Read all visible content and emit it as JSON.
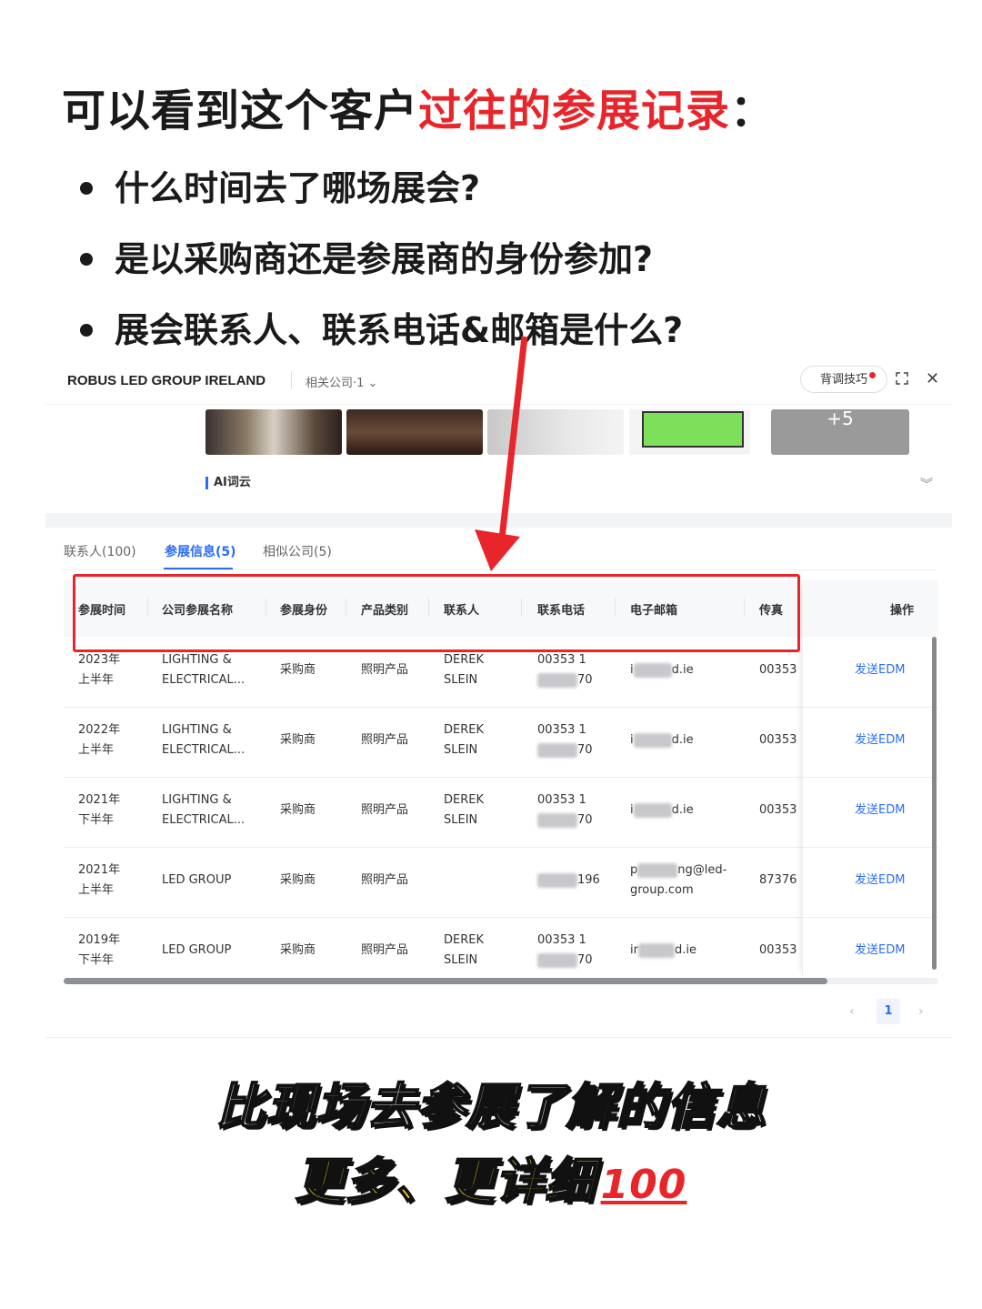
{
  "headline": {
    "prefix": "可以看到这个客户",
    "highlight": "过往的参展记录",
    "suffix": "：",
    "highlight_color": "#e8252a"
  },
  "bullets": [
    "什么时间去了哪场展会?",
    "是以采购商还是参展商的身份参加?",
    "展会联系人、联系电话&邮箱是什么?"
  ],
  "panel": {
    "company": "ROBUS LED GROUP IRELAND",
    "related": "相关公司·1",
    "tips_button": "背调技巧",
    "thumbnail_more": "+5",
    "ai_section": "AI词云",
    "tabs": [
      {
        "label": "联系人(100)",
        "active": false
      },
      {
        "label": "参展信息(5)",
        "active": true
      },
      {
        "label": "相似公司(5)",
        "active": false
      }
    ],
    "columns": [
      "参展时间",
      "公司参展名称",
      "参展身份",
      "产品类别",
      "联系人",
      "联系电话",
      "电子邮箱",
      "传真",
      "操作"
    ],
    "rows": [
      {
        "time1": "2023年",
        "time2": "上半年",
        "name1": "LIGHTING &",
        "name2": "ELECTRICAL...",
        "role": "采购商",
        "category": "照明产品",
        "contact1": "DEREK",
        "contact2": "SLEIN",
        "phone1": "00353 1",
        "phone2": "70",
        "email_pre": "i",
        "email_post": "d.ie",
        "fax": "00353",
        "action": "发送EDM"
      },
      {
        "time1": "2022年",
        "time2": "上半年",
        "name1": "LIGHTING &",
        "name2": "ELECTRICAL...",
        "role": "采购商",
        "category": "照明产品",
        "contact1": "DEREK",
        "contact2": "SLEIN",
        "phone1": "00353 1",
        "phone2": "70",
        "email_pre": "i",
        "email_post": "d.ie",
        "fax": "00353",
        "action": "发送EDM"
      },
      {
        "time1": "2021年",
        "time2": "下半年",
        "name1": "LIGHTING &",
        "name2": "ELECTRICAL...",
        "role": "采购商",
        "category": "照明产品",
        "contact1": "DEREK",
        "contact2": "SLEIN",
        "phone1": "00353 1",
        "phone2": "70",
        "email_pre": "i",
        "email_post": "d.ie",
        "fax": "00353",
        "action": "发送EDM"
      },
      {
        "time1": "2021年",
        "time2": "上半年",
        "name1": "LED GROUP",
        "name2": "",
        "role": "采购商",
        "category": "照明产品",
        "contact1": "",
        "contact2": "",
        "phone1": "196",
        "phone2": "",
        "email_pre": "p",
        "email_post": "ng@led-",
        "email_line2": "group.com",
        "fax": "87376",
        "action": "发送EDM"
      },
      {
        "time1": "2019年",
        "time2": "下半年",
        "name1": "LED GROUP",
        "name2": "",
        "role": "采购商",
        "category": "照明产品",
        "contact1": "DEREK",
        "contact2": "SLEIN",
        "phone1": "00353 1",
        "phone2": "70",
        "email_pre": "ir",
        "email_post": "d.ie",
        "fax": "00353",
        "action": "发送EDM"
      }
    ],
    "pagination": {
      "current": "1"
    }
  },
  "slogan": {
    "line1": "比现场去参展了解的信息",
    "line2": "更多、更详细",
    "emoji": "100"
  },
  "colors": {
    "accent_blue": "#2a6cf6",
    "annotation_red": "#e8252a",
    "slogan_yellow": "#ffe11a"
  }
}
